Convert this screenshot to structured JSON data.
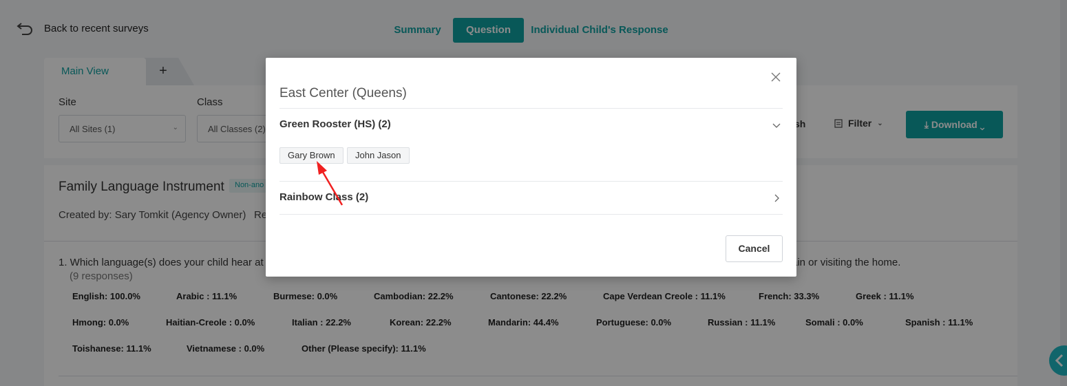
{
  "nav": {
    "back_label": "Back to recent surveys",
    "tabs": [
      "Summary",
      "Question",
      "Individual Child's Response"
    ],
    "active_tab": "Question"
  },
  "views": {
    "main_view_label": "Main View",
    "add_label": "+"
  },
  "filters": {
    "site_label": "Site",
    "site_value": "All Sites (1)",
    "class_label": "Class",
    "class_value": "All Classes (2)",
    "partial_text": "sh",
    "filter_label": "Filter",
    "download_label": "Download"
  },
  "survey": {
    "title": "Family Language Instrument",
    "badge": "Non-ano",
    "created_by": "Created by: Sary Tomkit (Agency Owner)",
    "created_suffix": "Re",
    "question_left": "1. Which language(s) does your child hear at h",
    "question_right": "ain or visiting the home.",
    "responses": "(9 responses)",
    "stats": [
      "English: 100.0%",
      "Arabic : 11.1%",
      "Burmese: 0.0%",
      "Cambodian: 22.2%",
      "Cantonese: 22.2%",
      "Cape Verdean Creole : 11.1%",
      "French: 33.3%",
      "Greek : 11.1%",
      "Hmong: 0.0%",
      "Haitian-Creole : 0.0%",
      "Italian : 22.2%",
      "Korean: 22.2%",
      "Mandarin: 44.4%",
      "Portuguese: 0.0%",
      "Russian : 11.1%",
      "Somali : 0.0%",
      "Spanish : 11.1%",
      "Toishanese: 11.1%",
      "Vietnamese : 0.0%",
      "Other (Please specify): 11.1%"
    ]
  },
  "modal": {
    "title": "East Center (Queens)",
    "groups": [
      {
        "name": "Green Rooster (HS) (2)",
        "children": [
          "Gary Brown",
          "John Jason"
        ]
      },
      {
        "name": "Rainbow Class (2)",
        "children": []
      }
    ],
    "cancel_label": "Cancel"
  },
  "colors": {
    "accent": "#10a0a0",
    "annotation_arrow": "#f02020"
  },
  "icons": {
    "back": "back-arrow-icon",
    "close": "close-icon",
    "expanded": "chevron-down-icon",
    "collapsed": "chevron-right-icon",
    "download": "download-icon",
    "filter": "filter-icon"
  }
}
